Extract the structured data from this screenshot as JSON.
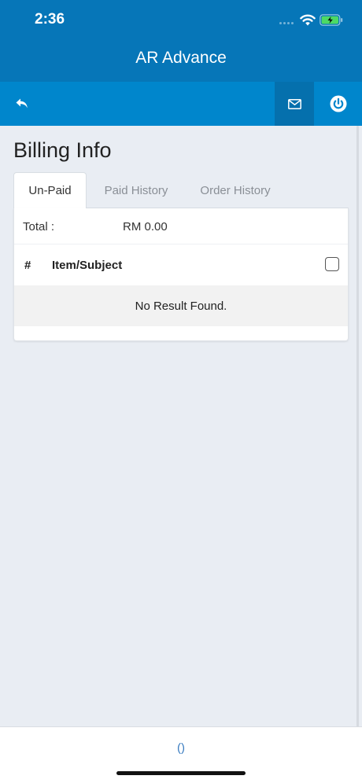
{
  "status_bar": {
    "time": "2:36"
  },
  "header": {
    "title": "AR Advance"
  },
  "toolbar": {
    "back_icon": "reply-arrow-icon",
    "mail_icon": "envelope-icon",
    "power_icon": "power-icon"
  },
  "page": {
    "title": "Billing Info"
  },
  "tabs": [
    {
      "label": "Un-Paid",
      "active": true
    },
    {
      "label": "Paid History",
      "active": false
    },
    {
      "label": "Order History",
      "active": false
    }
  ],
  "summary": {
    "total_label": "Total :",
    "total_value": "RM 0.00"
  },
  "table": {
    "columns": [
      "#",
      "Item/Subject"
    ],
    "select_all_checked": false,
    "empty_message": "No Result Found."
  },
  "bottom": {
    "mark": "()"
  },
  "colors": {
    "header": "#0676b8",
    "toolbar": "#0086cc",
    "toolbar_highlight": "#0570ad",
    "page_bg": "#e9edf3"
  }
}
